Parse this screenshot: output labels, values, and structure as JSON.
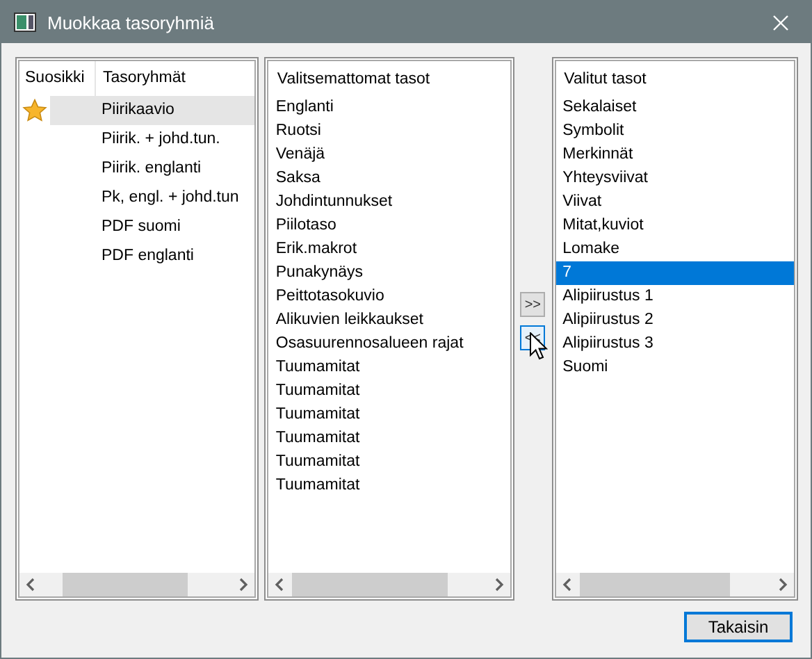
{
  "window": {
    "title": "Muokkaa tasoryhmiä"
  },
  "groups": {
    "columns": [
      "Suosikki",
      "Tasoryhmät"
    ],
    "rows": [
      {
        "name": "Piirikaavio",
        "favorite": true,
        "selected": true
      },
      {
        "name": "Piirik. + johd.tun.",
        "favorite": false,
        "selected": false
      },
      {
        "name": "Piirik. englanti",
        "favorite": false,
        "selected": false
      },
      {
        "name": "Pk, engl. + johd.tun",
        "favorite": false,
        "selected": false
      },
      {
        "name": "PDF suomi",
        "favorite": false,
        "selected": false
      },
      {
        "name": "PDF englanti",
        "favorite": false,
        "selected": false
      }
    ]
  },
  "unselected_layers": {
    "title": "Valitsemattomat tasot",
    "items": [
      {
        "label": "Englanti",
        "selected": false
      },
      {
        "label": "Ruotsi",
        "selected": false
      },
      {
        "label": "Venäjä",
        "selected": false
      },
      {
        "label": "Saksa",
        "selected": false
      },
      {
        "label": "Johdintunnukset",
        "selected": false
      },
      {
        "label": "Piilotaso",
        "selected": false
      },
      {
        "label": "Erik.makrot",
        "selected": false
      },
      {
        "label": "Punakynäys",
        "selected": false
      },
      {
        "label": "Peittotasokuvio",
        "selected": false
      },
      {
        "label": "Alikuvien leikkaukset",
        "selected": false
      },
      {
        "label": "Osasuurennosalueen rajat",
        "selected": false
      },
      {
        "label": "Tuumamitat",
        "selected": false
      },
      {
        "label": "Tuumamitat",
        "selected": false
      },
      {
        "label": "Tuumamitat",
        "selected": false
      },
      {
        "label": "Tuumamitat",
        "selected": false
      },
      {
        "label": "Tuumamitat",
        "selected": false
      },
      {
        "label": "Tuumamitat",
        "selected": false
      }
    ]
  },
  "move_buttons": [
    {
      "label": ">>",
      "focused": false
    },
    {
      "label": "<<",
      "focused": true
    }
  ],
  "selected_layers": {
    "title": "Valitut tasot",
    "items": [
      {
        "label": "Sekalaiset",
        "selected": false
      },
      {
        "label": "Symbolit",
        "selected": false
      },
      {
        "label": "Merkinnät",
        "selected": false
      },
      {
        "label": "Yhteysviivat",
        "selected": false
      },
      {
        "label": "Viivat",
        "selected": false
      },
      {
        "label": "Mitat,kuviot",
        "selected": false
      },
      {
        "label": "Lomake",
        "selected": false
      },
      {
        "label": "7",
        "selected": true
      },
      {
        "label": "Alipiirustus 1",
        "selected": false
      },
      {
        "label": "Alipiirustus 2",
        "selected": false
      },
      {
        "label": "Alipiirustus 3",
        "selected": false
      },
      {
        "label": "Suomi",
        "selected": false
      }
    ]
  },
  "buttons": [
    {
      "label": "Takaisin"
    }
  ]
}
